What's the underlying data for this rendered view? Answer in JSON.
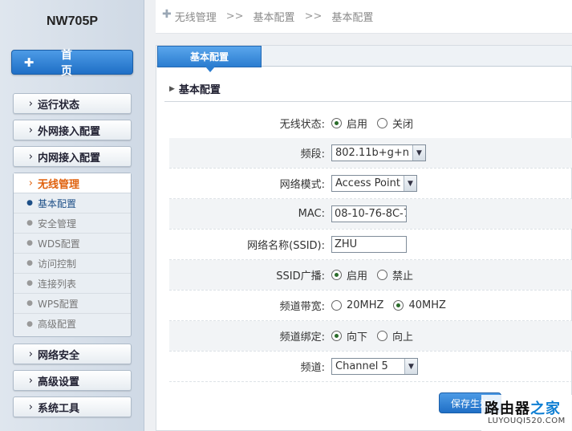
{
  "sidebar": {
    "brand": "NW705P",
    "home_label": "首 页",
    "menu": [
      {
        "label": "运行状态"
      },
      {
        "label": "外网接入配置"
      },
      {
        "label": "内网接入配置"
      }
    ],
    "active_group": {
      "label": "无线管理",
      "items": [
        "基本配置",
        "安全管理",
        "WDS配置",
        "访问控制",
        "连接列表",
        "WPS配置",
        "高级配置"
      ]
    },
    "menu_after": [
      {
        "label": "网络安全"
      },
      {
        "label": "高级设置"
      },
      {
        "label": "系统工具"
      }
    ],
    "arrow": "›",
    "bullet": "●"
  },
  "breadcrumb": {
    "icon": "✚",
    "items": [
      "无线管理",
      "基本配置",
      "基本配置"
    ],
    "separator": ">>"
  },
  "main": {
    "tab_label": "基本配置",
    "section_title": "基本配置",
    "form": {
      "wireless_status": {
        "label": "无线状态:",
        "options": [
          "启用",
          "关闭"
        ],
        "selected": 0
      },
      "band": {
        "label": "频段:",
        "value": "802.11b+g+n"
      },
      "network_mode": {
        "label": "网络模式:",
        "value": "Access Point"
      },
      "mac": {
        "label": "MAC:",
        "value": "08-10-76-8C-7"
      },
      "ssid": {
        "label": "网络名称(SSID):",
        "value": "ZHU"
      },
      "ssid_broadcast": {
        "label": "SSID广播:",
        "options": [
          "启用",
          "禁止"
        ],
        "selected": 0
      },
      "channel_width": {
        "label": "频道带宽:",
        "options": [
          "20MHZ",
          "40MHZ"
        ],
        "selected": 1
      },
      "channel_bind": {
        "label": "频道绑定:",
        "options": [
          "向下",
          "向上"
        ],
        "selected": 0
      },
      "channel": {
        "label": "频道:",
        "value": "Channel 5"
      }
    },
    "save_label": "保存生效"
  },
  "watermark": {
    "cn_dark": "路由器",
    "cn_highlight": "之家",
    "en": "LUYOUQI520.COM"
  },
  "colors": {
    "accent": "#2b7dd0",
    "active_menu": "#e0620e"
  }
}
